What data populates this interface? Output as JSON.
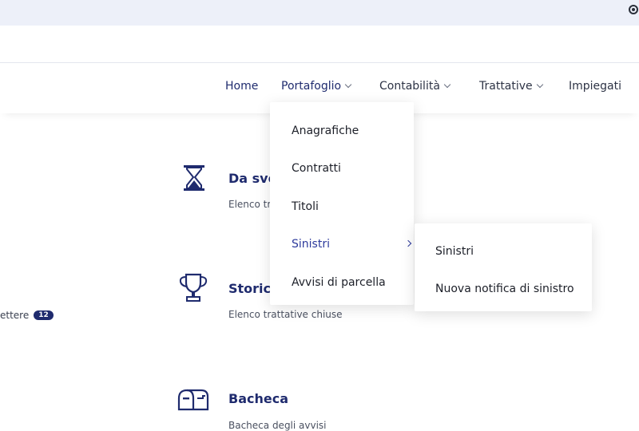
{
  "nav": {
    "home": "Home",
    "portafoglio": "Portafoglio",
    "contabilita": "Contabilità",
    "trattative": "Trattative",
    "impiegati": "Impiegati"
  },
  "dropdown": {
    "items": [
      "Anagrafiche",
      "Contratti",
      "Titoli",
      "Sinistri",
      "Avvisi di parcella"
    ]
  },
  "submenu": {
    "items": [
      "Sinistri",
      "Nuova notifica di sinistro"
    ]
  },
  "cards": [
    {
      "title": "Da svo",
      "subtitle": "Elenco tr",
      "icon": "hourglass-icon"
    },
    {
      "title": "Storico",
      "subtitle": "Elenco trattative chiuse",
      "icon": "trophy-icon"
    },
    {
      "title": "Bacheca",
      "subtitle": "Bacheca degli avvisi",
      "icon": "mailbox-icon"
    }
  ],
  "left": {
    "text": "ettere",
    "badge": "12"
  },
  "colors": {
    "brand": "#1f2b6e",
    "active": "#2d3a9c",
    "topbar": "#edf0f9"
  }
}
